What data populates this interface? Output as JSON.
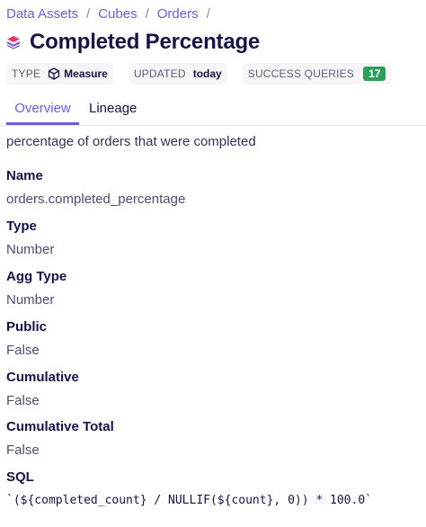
{
  "breadcrumb": {
    "items": [
      "Data Assets",
      "Cubes",
      "Orders"
    ],
    "separator": "/"
  },
  "header": {
    "title": "Completed Percentage",
    "icon": "cube-stack-icon"
  },
  "meta": {
    "type_label": "TYPE",
    "type_value": "Measure",
    "type_icon": "cube-outline-icon",
    "updated_label": "UPDATED",
    "updated_value": "today",
    "success_label": "SUCCESS QUERIES",
    "success_count": "17"
  },
  "tabs": [
    {
      "label": "Overview",
      "active": true
    },
    {
      "label": "Lineage",
      "active": false
    }
  ],
  "content": {
    "description": "percentage of orders that were completed",
    "fields": [
      {
        "label": "Name",
        "value": "orders.completed_percentage"
      },
      {
        "label": "Type",
        "value": "Number"
      },
      {
        "label": "Agg Type",
        "value": "Number"
      },
      {
        "label": "Public",
        "value": "False"
      },
      {
        "label": "Cumulative",
        "value": "False"
      },
      {
        "label": "Cumulative Total",
        "value": "False"
      },
      {
        "label": "SQL",
        "value": "`(${completed_count} / NULLIF(${count}, 0)) * 100.0`"
      }
    ]
  },
  "colors": {
    "accent": "#6a5fd6",
    "success_badge": "#2e9e5b",
    "text": "#141446"
  }
}
